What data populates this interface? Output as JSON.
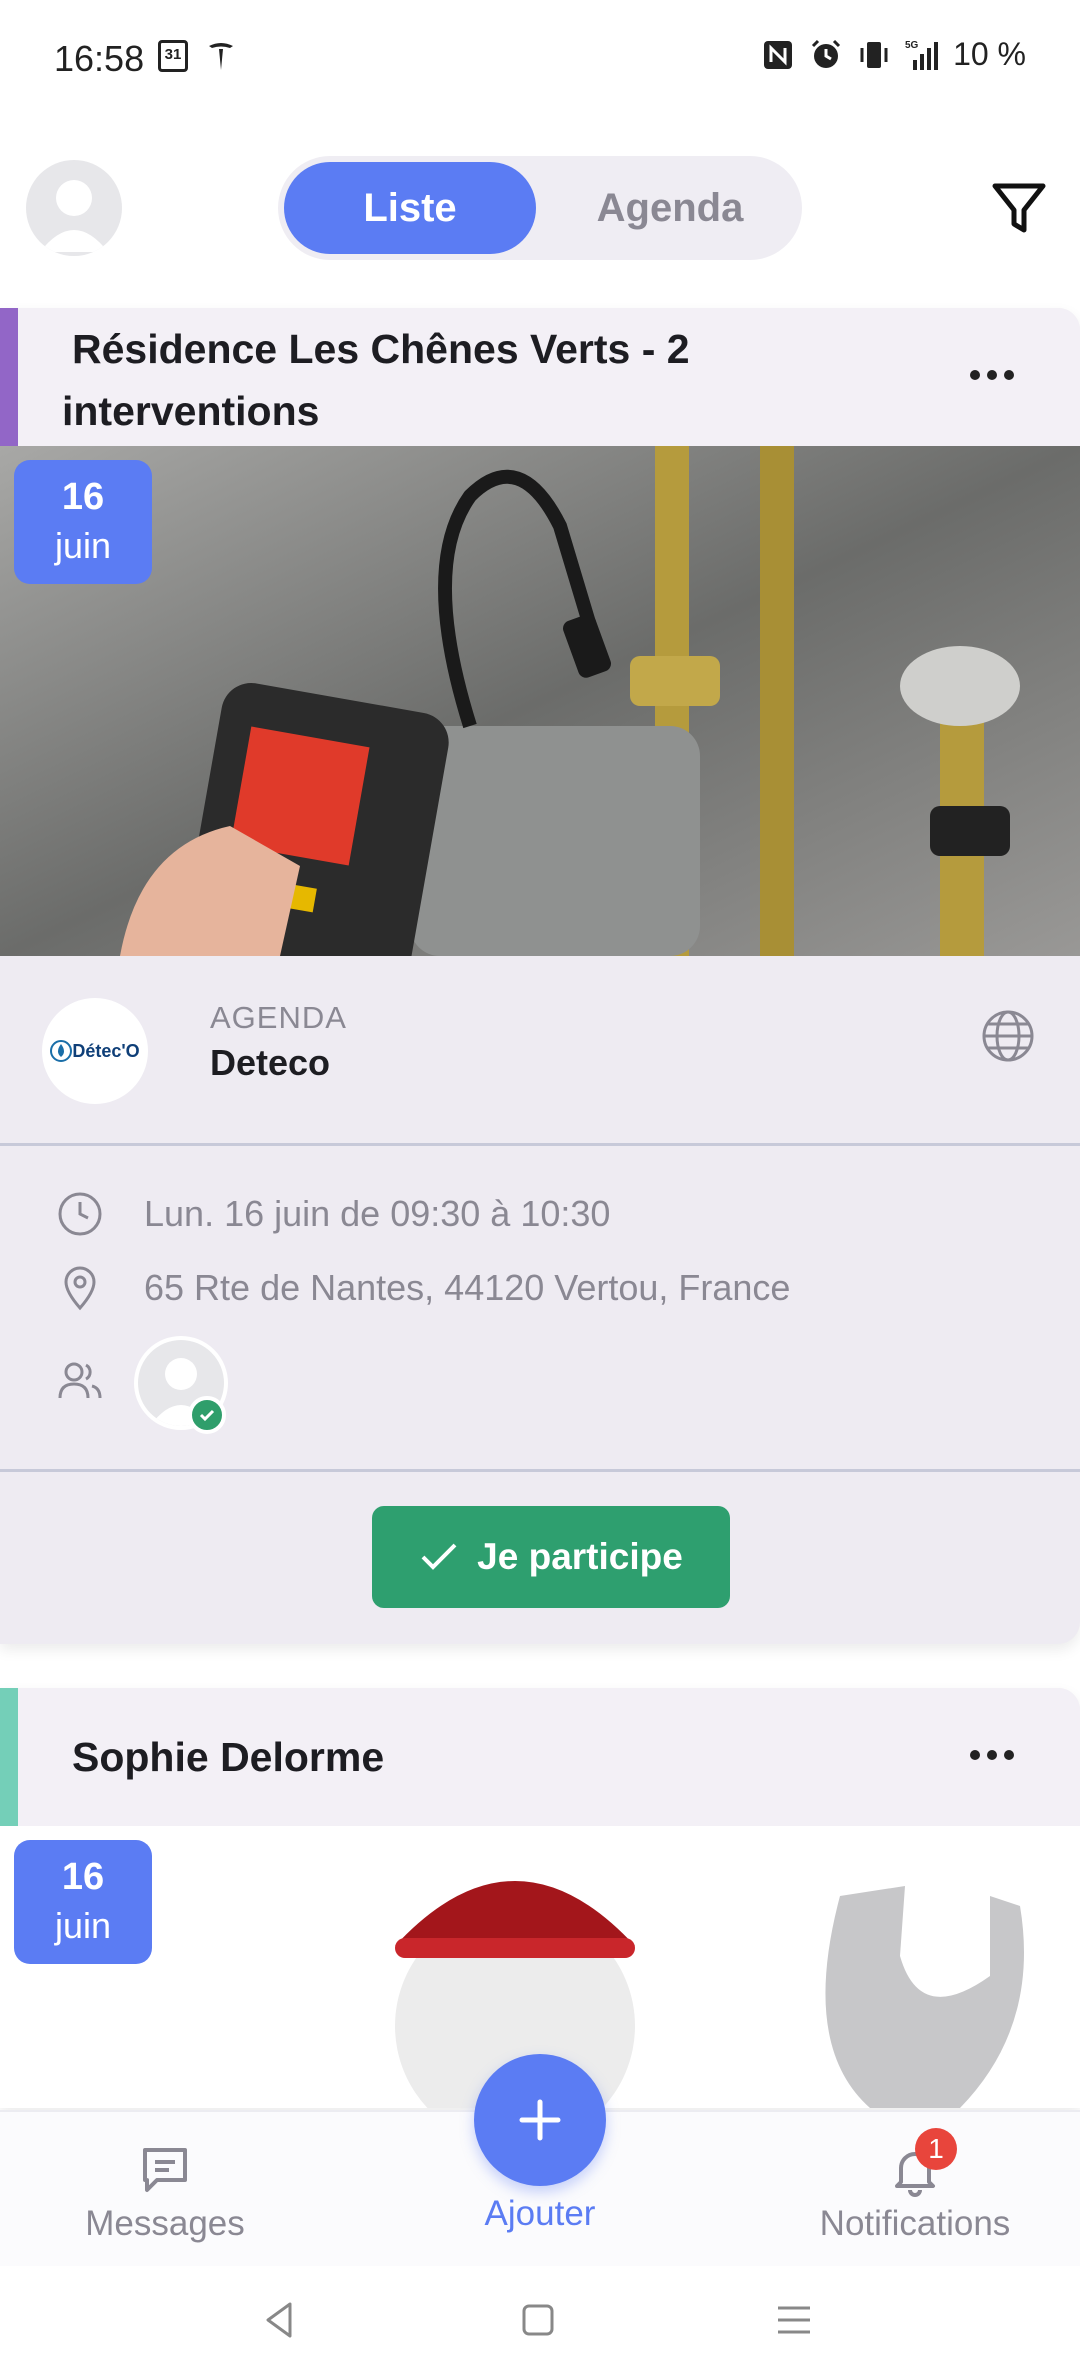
{
  "status_bar": {
    "time": "16:58",
    "calendar_day": "31",
    "network": "5G",
    "battery": "10 %"
  },
  "header": {
    "tabs": [
      {
        "label": "Liste",
        "active": true
      },
      {
        "label": "Agenda",
        "active": false
      }
    ]
  },
  "cards": [
    {
      "accent_color": "#9266c7",
      "title": "Résidence Les Chênes Verts - 2 interventions",
      "date_day": "16",
      "date_month": "juin",
      "agenda_label": "AGENDA",
      "organization": "Deteco",
      "organization_logo_text": "Détec'O",
      "time_range": "Lun. 16 juin de 09:30 à 10:30",
      "address": "65 Rte de Nantes, 44120 Vertou, France",
      "participate_label": "Je participe"
    },
    {
      "accent_color": "#74cfb8",
      "title": "Sophie Delorme",
      "date_day": "16",
      "date_month": "juin"
    }
  ],
  "bottom_nav": {
    "messages": "Messages",
    "add": "Ajouter",
    "notifications": "Notifications",
    "notification_count": "1"
  },
  "colors": {
    "primary": "#5b7cf3",
    "success": "#2e9f6f",
    "badge": "#e8453c"
  }
}
